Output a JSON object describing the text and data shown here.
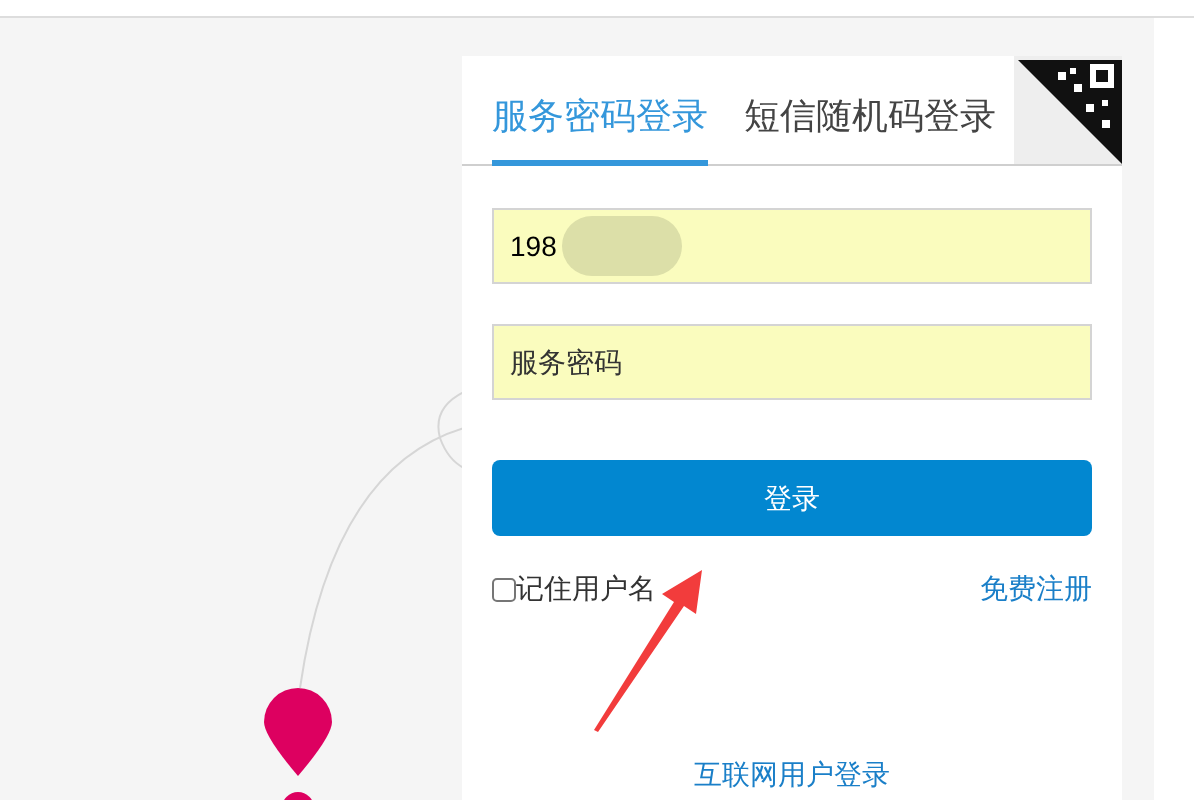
{
  "tabs": [
    {
      "label": "服务密码登录",
      "selected": true
    },
    {
      "label": "短信随机码登录",
      "selected": false
    }
  ],
  "phone_field": {
    "value": "198"
  },
  "password_field": {
    "placeholder": "服务密码"
  },
  "login_button": "登录",
  "remember": {
    "label": "记住用户名",
    "checked": false
  },
  "register_link": "免费注册",
  "internet_login_link": "互联网用户登录"
}
